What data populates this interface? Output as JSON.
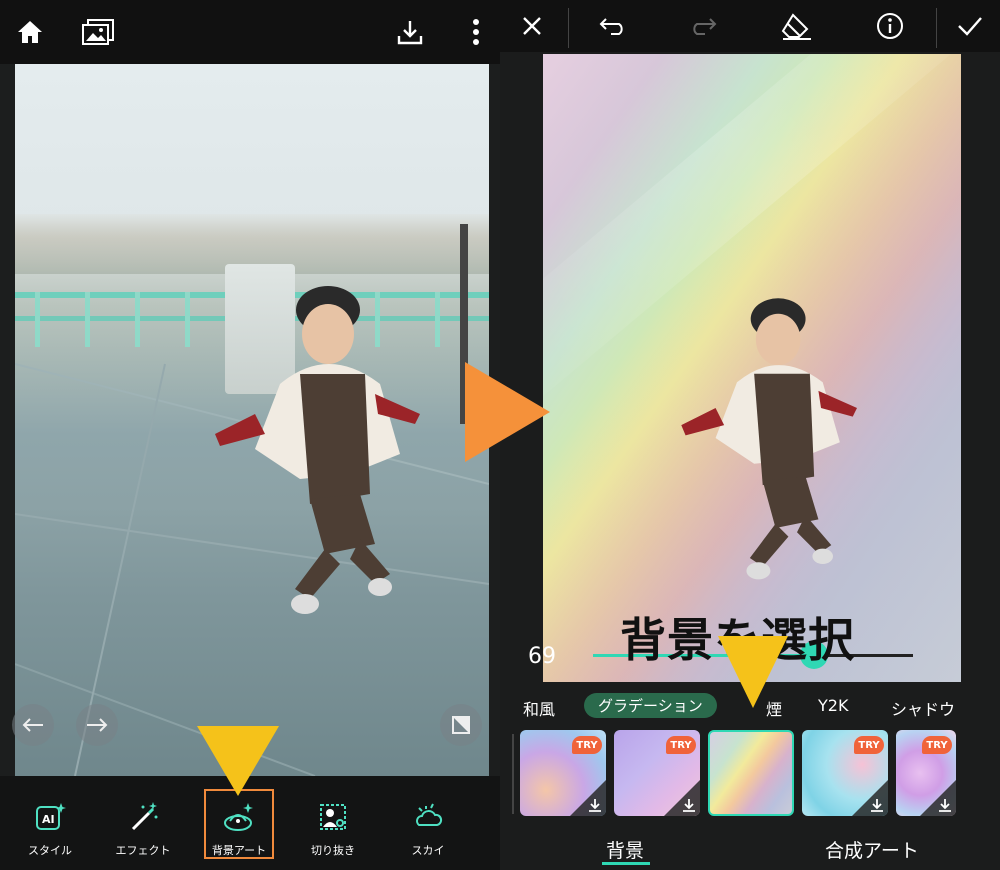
{
  "left_panel": {
    "toolbar": {
      "home_icon": "home-icon",
      "gallery_icon": "gallery-icon",
      "download_icon": "download-icon",
      "more_icon": "more-vertical-icon"
    },
    "tools": [
      {
        "label": "スタイル",
        "icon": "ai-sparkle-icon"
      },
      {
        "label": "エフェクト",
        "icon": "magic-wand-icon"
      },
      {
        "label": "背景アート",
        "icon": "background-art-icon"
      },
      {
        "label": "切り抜き",
        "icon": "cutout-icon"
      },
      {
        "label": "スカイ",
        "icon": "sky-icon"
      }
    ],
    "highlight_color": "#f08a3c"
  },
  "right_panel": {
    "toolbar": {
      "close_icon": "close-icon",
      "undo_icon": "undo-icon",
      "redo_icon": "redo-icon",
      "eraser_icon": "eraser-icon",
      "info_icon": "info-icon",
      "confirm_icon": "check-icon"
    },
    "caption": "背景を選択",
    "slider": {
      "value": "69",
      "fraction": 0.69
    },
    "categories": [
      {
        "label": "和風",
        "active": false
      },
      {
        "label": "グラデーション",
        "active": true
      },
      {
        "label": "煙",
        "active": false
      },
      {
        "label": "Y2K",
        "active": false
      },
      {
        "label": "シャドウ",
        "active": false
      }
    ],
    "thumbnails": [
      {
        "badge": "TRY",
        "selected": false
      },
      {
        "badge": "TRY",
        "selected": false
      },
      {
        "badge": "",
        "selected": true
      },
      {
        "badge": "TRY",
        "selected": false
      },
      {
        "badge": "TRY",
        "selected": false
      }
    ],
    "bottom_tabs": [
      {
        "label": "背景",
        "active": true
      },
      {
        "label": "合成アート",
        "active": false
      }
    ],
    "accent_color": "#2fd8b4"
  },
  "annotation_colors": {
    "pointer": "#f5c21a",
    "arrow": "#f5913a"
  }
}
